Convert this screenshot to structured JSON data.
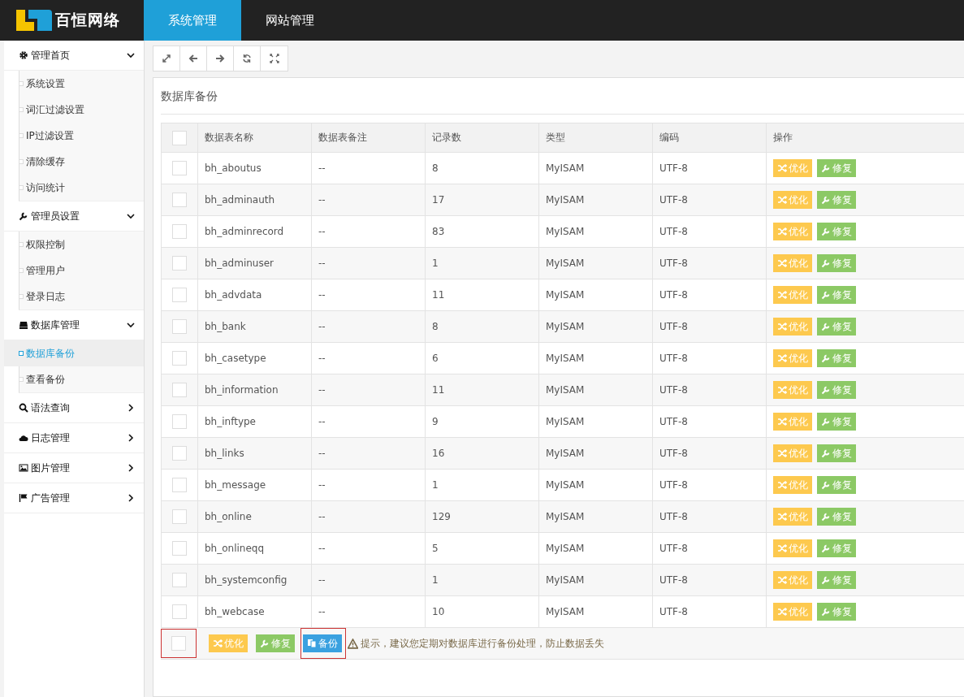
{
  "header": {
    "logo_text": "百恒网络",
    "tabs": [
      {
        "label": "系统管理",
        "selected": true
      },
      {
        "label": "网站管理",
        "selected": false
      }
    ]
  },
  "sidebar": {
    "groups": [
      {
        "label": "管理首页",
        "expanded": true,
        "items": [
          {
            "label": "系统设置",
            "selected": false
          },
          {
            "label": "词汇过滤设置",
            "selected": false
          },
          {
            "label": "IP过滤设置",
            "selected": false
          },
          {
            "label": "清除缓存",
            "selected": false
          },
          {
            "label": "访问统计",
            "selected": false
          }
        ]
      },
      {
        "label": "管理员设置",
        "expanded": true,
        "items": [
          {
            "label": "权限控制",
            "selected": false
          },
          {
            "label": "管理用户",
            "selected": false
          },
          {
            "label": "登录日志",
            "selected": false
          }
        ]
      },
      {
        "label": "数据库管理",
        "expanded": true,
        "items": [
          {
            "label": "数据库备份",
            "selected": true
          },
          {
            "label": "查看备份",
            "selected": false
          }
        ]
      },
      {
        "label": "语法查询",
        "expanded": false
      },
      {
        "label": "日志管理",
        "expanded": false
      },
      {
        "label": "图片管理",
        "expanded": false
      },
      {
        "label": "广告管理",
        "expanded": false
      }
    ]
  },
  "panel": {
    "title": "数据库备份",
    "table": {
      "columns": [
        "数据表名称",
        "数据表备注",
        "记录数",
        "类型",
        "编码",
        "操作"
      ],
      "header_checked": false,
      "rows": [
        {
          "checked": false,
          "name": "bh_aboutus",
          "note": "--",
          "records": "8",
          "type": "MyISAM",
          "encoding": "UTF-8",
          "actions": [
            {
              "kind": "optimize",
              "label": "优化"
            },
            {
              "kind": "repair",
              "label": "修复"
            }
          ]
        },
        {
          "checked": false,
          "name": "bh_adminauth",
          "note": "--",
          "records": "17",
          "type": "MyISAM",
          "encoding": "UTF-8",
          "actions": [
            {
              "kind": "optimize",
              "label": "优化"
            },
            {
              "kind": "repair",
              "label": "修复"
            }
          ]
        },
        {
          "checked": false,
          "name": "bh_adminrecord",
          "note": "--",
          "records": "83",
          "type": "MyISAM",
          "encoding": "UTF-8",
          "actions": [
            {
              "kind": "optimize",
              "label": "优化"
            },
            {
              "kind": "repair",
              "label": "修复"
            }
          ]
        },
        {
          "checked": false,
          "name": "bh_adminuser",
          "note": "--",
          "records": "1",
          "type": "MyISAM",
          "encoding": "UTF-8",
          "actions": [
            {
              "kind": "optimize",
              "label": "优化"
            },
            {
              "kind": "repair",
              "label": "修复"
            }
          ]
        },
        {
          "checked": false,
          "name": "bh_advdata",
          "note": "--",
          "records": "11",
          "type": "MyISAM",
          "encoding": "UTF-8",
          "actions": [
            {
              "kind": "optimize",
              "label": "优化"
            },
            {
              "kind": "repair",
              "label": "修复"
            }
          ]
        },
        {
          "checked": false,
          "name": "bh_bank",
          "note": "--",
          "records": "8",
          "type": "MyISAM",
          "encoding": "UTF-8",
          "actions": [
            {
              "kind": "optimize",
              "label": "优化"
            },
            {
              "kind": "repair",
              "label": "修复"
            }
          ]
        },
        {
          "checked": false,
          "name": "bh_casetype",
          "note": "--",
          "records": "6",
          "type": "MyISAM",
          "encoding": "UTF-8",
          "actions": [
            {
              "kind": "optimize",
              "label": "优化"
            },
            {
              "kind": "repair",
              "label": "修复"
            }
          ]
        },
        {
          "checked": false,
          "name": "bh_information",
          "note": "--",
          "records": "11",
          "type": "MyISAM",
          "encoding": "UTF-8",
          "actions": [
            {
              "kind": "optimize",
              "label": "优化"
            },
            {
              "kind": "repair",
              "label": "修复"
            }
          ]
        },
        {
          "checked": false,
          "name": "bh_inftype",
          "note": "--",
          "records": "9",
          "type": "MyISAM",
          "encoding": "UTF-8",
          "actions": [
            {
              "kind": "optimize",
              "label": "优化"
            },
            {
              "kind": "repair",
              "label": "修复"
            }
          ]
        },
        {
          "checked": false,
          "name": "bh_links",
          "note": "--",
          "records": "16",
          "type": "MyISAM",
          "encoding": "UTF-8",
          "actions": [
            {
              "kind": "optimize",
              "label": "优化"
            },
            {
              "kind": "repair",
              "label": "修复"
            }
          ]
        },
        {
          "checked": false,
          "name": "bh_message",
          "note": "--",
          "records": "1",
          "type": "MyISAM",
          "encoding": "UTF-8",
          "actions": [
            {
              "kind": "optimize",
              "label": "优化"
            },
            {
              "kind": "repair",
              "label": "修复"
            }
          ]
        },
        {
          "checked": false,
          "name": "bh_online",
          "note": "--",
          "records": "129",
          "type": "MyISAM",
          "encoding": "UTF-8",
          "actions": [
            {
              "kind": "optimize",
              "label": "优化"
            },
            {
              "kind": "repair",
              "label": "修复"
            }
          ]
        },
        {
          "checked": false,
          "name": "bh_onlineqq",
          "note": "--",
          "records": "5",
          "type": "MyISAM",
          "encoding": "UTF-8",
          "actions": [
            {
              "kind": "optimize",
              "label": "优化"
            },
            {
              "kind": "repair",
              "label": "修复"
            }
          ]
        },
        {
          "checked": false,
          "name": "bh_systemconfig",
          "note": "--",
          "records": "1",
          "type": "MyISAM",
          "encoding": "UTF-8",
          "actions": [
            {
              "kind": "optimize",
              "label": "优化"
            },
            {
              "kind": "repair",
              "label": "修复"
            }
          ]
        },
        {
          "checked": false,
          "name": "bh_webcase",
          "note": "--",
          "records": "10",
          "type": "MyISAM",
          "encoding": "UTF-8",
          "actions": [
            {
              "kind": "optimize",
              "label": "优化"
            },
            {
              "kind": "repair",
              "label": "修复"
            }
          ]
        }
      ],
      "footer": {
        "checked": false,
        "checkbox_highlighted": true,
        "actions": [
          {
            "kind": "optimize",
            "label": "优化",
            "highlighted": false
          },
          {
            "kind": "repair",
            "label": "修复",
            "highlighted": false
          },
          {
            "kind": "backup",
            "label": "备份",
            "highlighted": true
          }
        ],
        "hint": "提示，建议您定期对数据库进行备份处理，防止数据丢失"
      }
    }
  }
}
